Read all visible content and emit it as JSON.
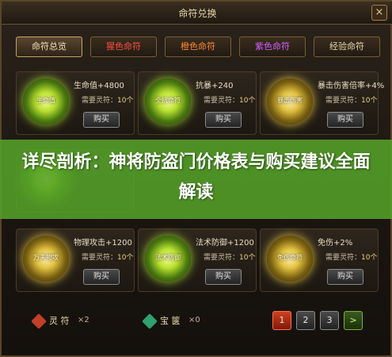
{
  "window": {
    "title": "命符兑换",
    "close": "×"
  },
  "tabs": [
    {
      "label": "命符总览"
    },
    {
      "label": "猩色命符"
    },
    {
      "label": "橙色命符"
    },
    {
      "label": "紫色命符"
    },
    {
      "label": "经验命符"
    }
  ],
  "cards": [
    {
      "orb_label": "生命值",
      "attr": "生命值+4800",
      "need_label": "需要灵符：",
      "need_num": "10个",
      "buy": "购买"
    },
    {
      "orb_label": "全抗命符",
      "attr": "抗暴+240",
      "need_label": "需要灵符：",
      "need_num": "10个",
      "buy": "购买"
    },
    {
      "orb_label": "暴击伤害",
      "attr": "暴击伤害倍率+4%",
      "need_label": "需要灵符：",
      "need_num": "10个",
      "buy": "购买"
    },
    {
      "orb_label": "万夫物攻",
      "attr": "物理攻击+1200",
      "need_label": "需要灵符：",
      "need_num": "10个",
      "buy": "购买"
    },
    {
      "orb_label": "法术防御",
      "attr": "法术防御+1200",
      "need_label": "需要灵符：",
      "need_num": "10个",
      "buy": "购买"
    },
    {
      "orb_label": "免伤命符",
      "attr": "免伤+2%",
      "need_label": "需要灵符：",
      "need_num": "10个",
      "buy": "购买"
    }
  ],
  "banner": {
    "text": "详尽剖析：神将防盗门价格表与购买建议全面解读"
  },
  "footer": {
    "currency1": {
      "label": "灵 符",
      "count": "×2"
    },
    "currency2": {
      "label": "宝 箧",
      "count": "×0"
    },
    "pages": [
      "1",
      "2",
      "3"
    ],
    "next": ">"
  },
  "colors": {
    "frame_border": "#5a4528",
    "active_page": "#d04020",
    "banner_green": "#54a028"
  }
}
